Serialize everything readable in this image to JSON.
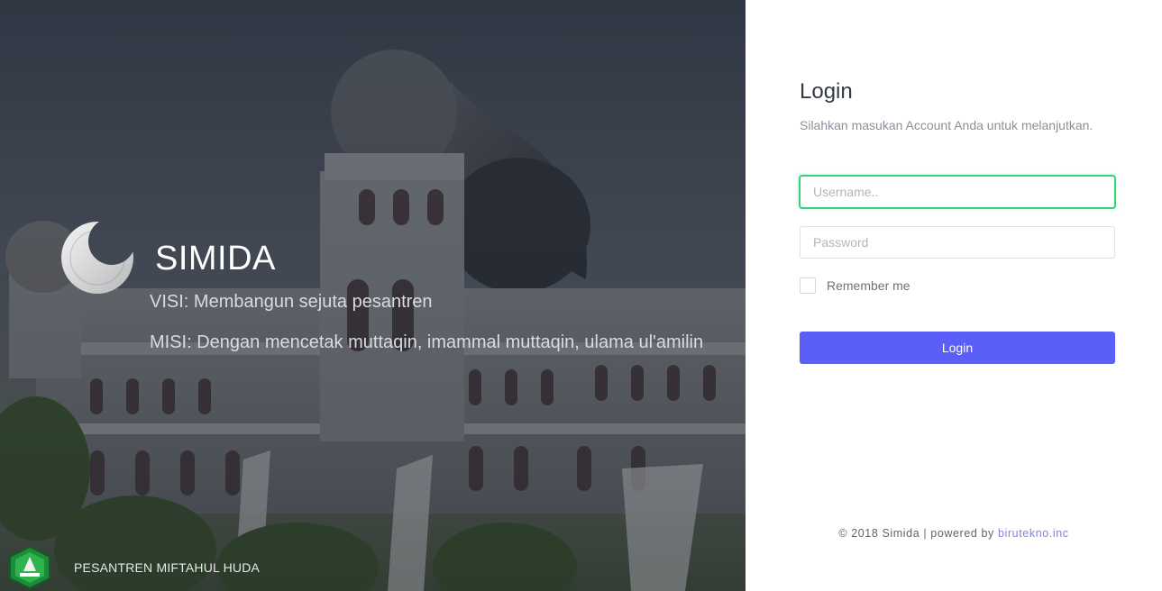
{
  "hero": {
    "brand_title": "SIMIDA",
    "visi": "VISI: Membangun sejuta pesantren",
    "misi": "MISI: Dengan mencetak muttaqin, imammal muttaqin, ulama ul'amilin",
    "institution": "PESANTREN MIFTAHUL HUDA"
  },
  "login": {
    "title": "Login",
    "subtitle": "Silahkan masukan Account Anda untuk melanjutkan.",
    "username_placeholder": "Username..",
    "password_placeholder": "Password",
    "remember_label": "Remember me",
    "button_label": "Login"
  },
  "footer": {
    "copyright_text": "© 2018 Simida | powered by ",
    "powered_by_link": "birutekno.inc"
  },
  "colors": {
    "accent": "#5b5ff7",
    "focus_border": "#36d27a",
    "link": "#7f83e6"
  }
}
